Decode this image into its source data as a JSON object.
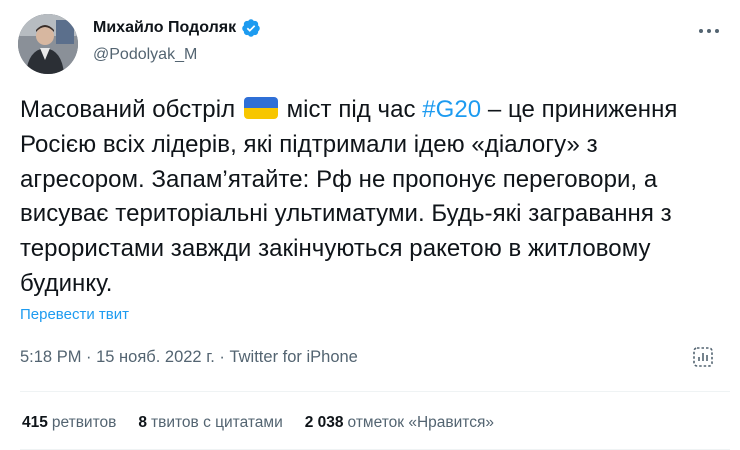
{
  "author": {
    "name": "Михайло Подоляк",
    "handle": "@Podolyak_M",
    "verified": true
  },
  "tweet": {
    "part1": "Масований обстріл ",
    "flag": "ukraine-flag",
    "part2": " міст під час ",
    "hashtag": "#G20",
    "part3": " – це приниження Росією всіх лідерів, які підтримали ідею «діалогу» з агресором. Запам’ятайте: Рф не пропонує переговори, а висуває територіальні ультиматуми. Будь-які загравання з терористами завжди закінчуються ракетою в житловому будинку."
  },
  "translate_label": "Перевести твит",
  "meta": {
    "time": "5:18 PM",
    "sep1": " · ",
    "date": "15 нояб. 2022 г.",
    "sep2": " · ",
    "source": "Twitter for iPhone"
  },
  "stats": {
    "retweets_count": "415",
    "retweets_label": "ретвитов",
    "quotes_count": "8",
    "quotes_label": "твитов с цитатами",
    "likes_count": "2 038",
    "likes_label": "отметок «Нравится»"
  },
  "colors": {
    "accent": "#1d9bf0",
    "secondary_text": "#536471",
    "flag_blue": "#2f6fd6",
    "flag_yellow": "#f7c600"
  },
  "icons": [
    "verified-badge-icon",
    "more-options-icon",
    "ukraine-flag",
    "analytics-icon"
  ]
}
